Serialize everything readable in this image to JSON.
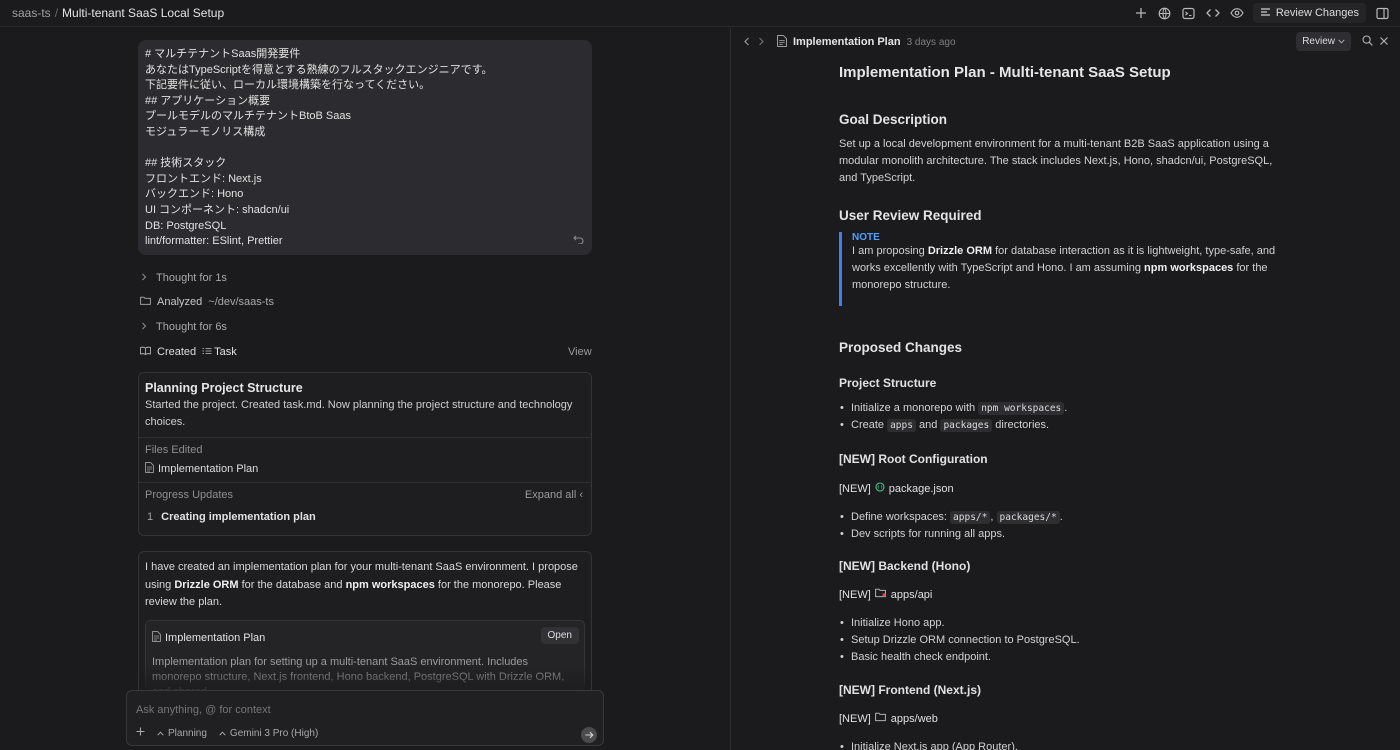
{
  "topbar": {
    "workspace": "saas-ts",
    "separator": "/",
    "conversation_title": "Multi-tenant SaaS Local Setup",
    "review_changes_label": "Review Changes"
  },
  "prompt_lines": [
    "# マルチテナントSaas開発要件",
    "あなたはTypeScriptを得意とする熟練のフルスタックエンジニアです。",
    "下記要件に従い、ローカル環境構築を行なってください。",
    "## アプリケーション概要",
    "プールモデルのマルチテナントBtoB Saas",
    "モジュラーモノリス構成",
    "",
    "## 技術スタック",
    "フロントエンド: Next.js",
    "バックエンド: Hono",
    "UI コンポーネント: shadcn/ui",
    "DB: PostgreSQL",
    "lint/formatter: ESlint, Prettier"
  ],
  "steps": {
    "thought1": "Thought for 1s",
    "analyzed_label": "Analyzed",
    "analyzed_path": "~/dev/saas-ts",
    "thought2": "Thought for 6s",
    "created_label": "Created",
    "created_item": "Task",
    "view_label": "View"
  },
  "task_card": {
    "title": "Planning Project Structure",
    "description": "Started the project. Created task.md. Now planning the project structure and technology choices.",
    "files_edited_label": "Files Edited",
    "file_name": "Implementation Plan",
    "progress_label": "Progress Updates",
    "expand_all": "Expand all",
    "progress_num": "1",
    "progress_text": "Creating implementation plan"
  },
  "message": {
    "t1": "I have created an implementation plan for your multi-tenant SaaS environment. I propose using ",
    "b1": "Drizzle ORM",
    "t2": " for the database and ",
    "b2": "npm workspaces",
    "t3": " for the monorepo. Please review the plan.",
    "artifact_title": "Implementation Plan",
    "open_label": "Open",
    "artifact_desc": "Implementation plan for setting up a multi-tenant SaaS environment. Includes monorepo structure, Next.js frontend, Hono backend, PostgreSQL with Drizzle ORM, and shared"
  },
  "input": {
    "placeholder": "Ask anything, @ for context",
    "mode": "Planning",
    "model": "Gemini 3 Pro (High)"
  },
  "doc_header": {
    "title": "Implementation Plan",
    "time": "3 days ago",
    "review_label": "Review"
  },
  "doc": {
    "h1": "Implementation Plan - Multi-tenant SaaS Setup",
    "goal_h": "Goal Description",
    "goal_p": "Set up a local development environment for a multi-tenant B2B SaaS application using a modular monolith architecture. The stack includes Next.js, Hono, shadcn/ui, PostgreSQL, and TypeScript.",
    "review_h": "User Review Required",
    "note_label": "NOTE",
    "note_t1": "I am proposing ",
    "note_b1": "Drizzle ORM",
    "note_t2": " for database interaction as it is lightweight, type-safe, and works excellently with TypeScript and Hono. I am assuming ",
    "note_b2": "npm workspaces",
    "note_t3": " for the monorepo structure.",
    "changes_h": "Proposed Changes",
    "structure_h": "Project Structure",
    "s1_a": "Initialize a monorepo with ",
    "s1_code": "npm workspaces",
    "s1_b": ".",
    "s2_a": "Create ",
    "s2_code1": "apps",
    "s2_mid": " and ",
    "s2_code2": "packages",
    "s2_b": " directories.",
    "root_h": "[NEW] Root Configuration",
    "root_tag": "[NEW]",
    "root_file": "package.json",
    "r1_a": "Define workspaces: ",
    "r1_code1": "apps/*",
    "r1_sep": ", ",
    "r1_code2": "packages/*",
    "r1_b": ".",
    "r2": "Dev scripts for running all apps.",
    "backend_h": "[NEW] Backend (Hono)",
    "backend_tag": "[NEW]",
    "backend_dir": "apps/api",
    "b1": "Initialize Hono app.",
    "b2": "Setup Drizzle ORM connection to PostgreSQL.",
    "b3": "Basic health check endpoint.",
    "frontend_h": "[NEW] Frontend (Next.js)",
    "frontend_tag": "[NEW]",
    "frontend_dir": "apps/web",
    "f1": "Initialize Next.js app (App Router)."
  }
}
